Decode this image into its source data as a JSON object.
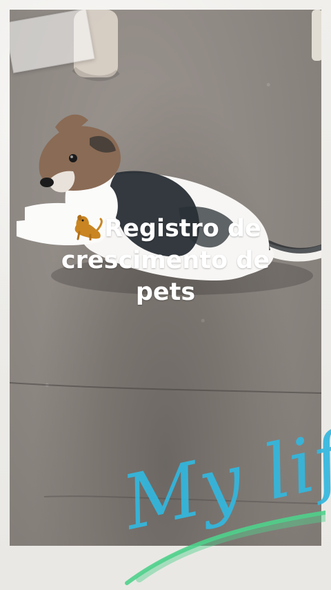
{
  "overlay": {
    "emoji": "🐕",
    "title_line_1": "Registro de",
    "title_line_2": "crescimento de",
    "title_line_3": "pets"
  },
  "decor": {
    "signature_text": "My life"
  },
  "colors": {
    "frame": "#ecebe7",
    "title": "#ffffff",
    "signature": "#32b8df",
    "swoosh": "#4fd08b"
  }
}
